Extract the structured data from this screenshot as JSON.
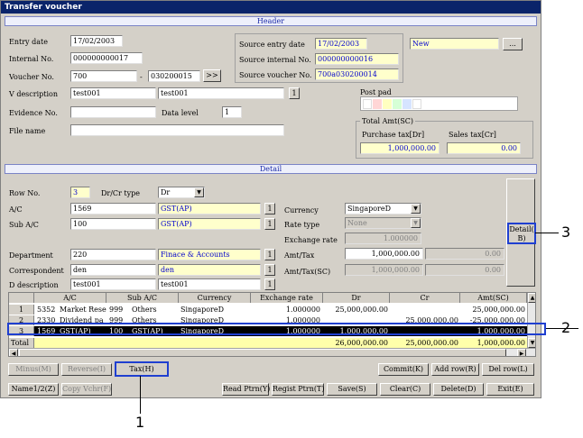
{
  "window": {
    "title": "Transfer voucher"
  },
  "header": {
    "band_label": "Header",
    "entry_date": {
      "label": "Entry date",
      "value": "17/02/2003"
    },
    "internal_no": {
      "label": "Internal No.",
      "value": "000000000017"
    },
    "voucher_no": {
      "label": "Voucher No.",
      "value": "700",
      "sep": "-",
      "value2": "030200015",
      "button": ">>"
    },
    "v_description": {
      "label": "V description",
      "value1": "test001",
      "value2": "test001",
      "button": "1"
    },
    "evidence_no": {
      "label": "Evidence No.",
      "value": ""
    },
    "data_level": {
      "label": "Data level",
      "value": "1"
    },
    "file_name": {
      "label": "File name",
      "value": ""
    },
    "source_entry_date": {
      "label": "Source entry date",
      "value": "17/02/2003"
    },
    "source_internal_no": {
      "label": "Source internal No.",
      "value": "000000000016"
    },
    "source_voucher_no": {
      "label": "Source voucher No.",
      "value": "700a030200014"
    },
    "status": "New",
    "status_button": "...",
    "post_pad": {
      "label": "Post pad"
    },
    "total_amt": {
      "label": "Total Amt(SC)",
      "purchase_label": "Purchase tax[Dr]",
      "purchase_value": "1,000,000.00",
      "sales_label": "Sales tax[Cr]",
      "sales_value": "0.00"
    }
  },
  "detail": {
    "band_label": "Detail",
    "row_no": {
      "label": "Row No.",
      "value": "3"
    },
    "drcr_type": {
      "label": "Dr/Cr type",
      "value": "Dr"
    },
    "ac": {
      "label": "A/C",
      "code": "1569",
      "name": "GST(AP)",
      "button": "1"
    },
    "sub_ac": {
      "label": "Sub A/C",
      "code": "100",
      "name": "GST(AP)",
      "button": "1"
    },
    "department": {
      "label": "Department",
      "code": "220",
      "name": "Finace & Accounts",
      "button": "1"
    },
    "correspondent": {
      "label": "Correspondent",
      "code": "den",
      "name": "den",
      "button": "1"
    },
    "d_description": {
      "label": "D description",
      "value1": "test001",
      "value2": "test001",
      "button": "1"
    },
    "currency": {
      "label": "Currency",
      "value": "SingaporeD"
    },
    "rate_type": {
      "label": "Rate type",
      "value": "None"
    },
    "exchange_rate": {
      "label": "Exchange rate",
      "value": "1.000000"
    },
    "amt_tax": {
      "label": "Amt/Tax",
      "value1": "1,000,000.00",
      "value2": "0.00"
    },
    "amt_tax_sc": {
      "label": "Amt/Tax(SC)",
      "value1": "1,000,000.00",
      "value2": "0.00"
    },
    "detail_button": "Detail(\nB)"
  },
  "grid": {
    "columns": [
      "A/C",
      "Sub A/C",
      "Currency",
      "Exchange rate",
      "Dr",
      "Cr",
      "Amt(SC)"
    ],
    "rows": [
      {
        "no": "1",
        "ac": "5352",
        "ac_name": "Market Rese",
        "sub": "999",
        "sub_name": "Others",
        "currency": "SingaporeD",
        "rate": "1.000000",
        "dr": "25,000,000.00",
        "cr": "",
        "amt": "25,000,000.00"
      },
      {
        "no": "2",
        "ac": "2330",
        "ac_name": "Dividend pa",
        "sub": "999",
        "sub_name": "Others",
        "currency": "SingaporeD",
        "rate": "1.000000",
        "dr": "",
        "cr": "25,000,000.00",
        "amt": "-25,000,000.00"
      },
      {
        "no": "3",
        "ac": "1569",
        "ac_name": "GST(AP)",
        "sub": "100",
        "sub_name": "GST(AP)",
        "currency": "SingaporeD",
        "rate": "1.000000",
        "dr": "1,000,000.00",
        "cr": "",
        "amt": "1,000,000.00"
      }
    ],
    "total": {
      "label": "Total",
      "dr": "26,000,000.00",
      "cr": "25,000,000.00",
      "amt": "1,000,000.00"
    }
  },
  "buttons": {
    "minus": "Minus(M)",
    "reverse": "Reverse(I)",
    "tax": "Tax(H)",
    "commit": "Commit(K)",
    "add_row": "Add row(R)",
    "del_row": "Del row(L)",
    "name12": "Name1/2(Z)",
    "copy_vchr": "Copy Vchr(F)",
    "read_ptrn": "Read Ptrn(Y)",
    "regist_ptrn": "Regist Ptrn(T)",
    "save": "Save(S)",
    "clear": "Clear(C)",
    "delete": "Delete(D)",
    "exit": "Exit(E)"
  },
  "callouts": {
    "one": "1",
    "two": "2",
    "three": "3"
  }
}
